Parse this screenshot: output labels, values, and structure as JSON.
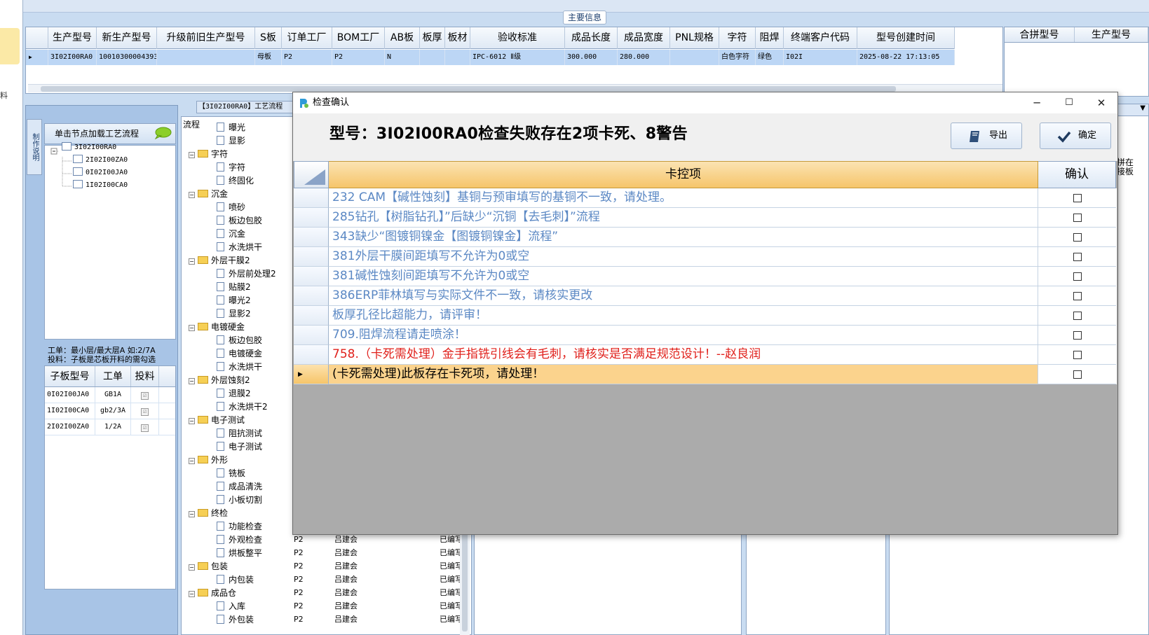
{
  "left_strip": {
    "text": "料"
  },
  "main_info": {
    "title": "主要信息",
    "columns": [
      "生产型号",
      "新生产型号",
      "升级前旧生产型号",
      "S板",
      "订单工厂",
      "BOM工厂",
      "AB板",
      "板厚",
      "板材",
      "验收标准",
      "成品长度",
      "成品宽度",
      "PNL规格",
      "字符",
      "阻焊",
      "终端客户代码",
      "型号创建时间"
    ],
    "row": [
      "3I02I00RA0",
      "10010300004393",
      "",
      "母板",
      "P2",
      "P2",
      "N",
      "",
      "",
      "IPC-6012 Ⅱ级",
      "300.000",
      "280.000",
      "",
      "白色字符",
      "绿色",
      "I02I",
      "2025-08-22 17:13:05"
    ]
  },
  "right_grid": {
    "columns": [
      "合拼型号",
      "生产型号"
    ]
  },
  "left_panel": {
    "vertical_tab": "制作说明",
    "tree_header": "单击节点加载工艺流程",
    "tree_nodes": [
      "3I02I00RA0",
      "2I02I00ZA0",
      "0I02I00JA0",
      "1I02I00CA0"
    ],
    "note_line1": "工单：最小层/最大层A 如:2/7A",
    "note_line2": "投料：子板是芯板开料的需勾选",
    "sub_columns": [
      "子板型号",
      "工单",
      "投料"
    ],
    "sub_rows": [
      {
        "model": "0I02I00JA0",
        "order": "GB1A",
        "feed": "☑"
      },
      {
        "model": "1I02I00CA0",
        "order": "gb2/3A",
        "feed": "☑"
      },
      {
        "model": "2I02I00ZA0",
        "order": "1/2A",
        "feed": "☑"
      }
    ]
  },
  "process": {
    "title": "【3I02I00RA0】工艺流程",
    "column_label": "流程",
    "nodes": [
      {
        "type": "doc",
        "label": "曝光"
      },
      {
        "type": "doc",
        "label": "显影"
      },
      {
        "type": "folder",
        "label": "字符"
      },
      {
        "type": "doc",
        "label": "字符"
      },
      {
        "type": "doc",
        "label": "终固化"
      },
      {
        "type": "folder",
        "label": "沉金"
      },
      {
        "type": "doc",
        "label": "喷砂"
      },
      {
        "type": "doc",
        "label": "板边包胶"
      },
      {
        "type": "doc",
        "label": "沉金"
      },
      {
        "type": "doc",
        "label": "水洗烘干"
      },
      {
        "type": "folder",
        "label": "外层干膜2"
      },
      {
        "type": "doc",
        "label": "外层前处理2"
      },
      {
        "type": "doc",
        "label": "贴膜2"
      },
      {
        "type": "doc",
        "label": "曝光2"
      },
      {
        "type": "doc",
        "label": "显影2"
      },
      {
        "type": "folder",
        "label": "电镀硬金"
      },
      {
        "type": "doc",
        "label": "板边包胶"
      },
      {
        "type": "doc",
        "label": "电镀硬金"
      },
      {
        "type": "doc",
        "label": "水洗烘干"
      },
      {
        "type": "folder",
        "label": "外层蚀刻2"
      },
      {
        "type": "doc",
        "label": "退膜2"
      },
      {
        "type": "doc",
        "label": "水洗烘干2"
      },
      {
        "type": "folder",
        "label": "电子测试"
      },
      {
        "type": "doc",
        "label": "阻抗测试"
      },
      {
        "type": "doc",
        "label": "电子测试"
      },
      {
        "type": "folder",
        "label": "外形"
      },
      {
        "type": "doc",
        "label": "铣板"
      },
      {
        "type": "doc",
        "label": "成品清洗"
      },
      {
        "type": "doc",
        "label": "小板切割"
      },
      {
        "type": "folder",
        "label": "终检"
      },
      {
        "type": "doc",
        "label": "功能检查"
      },
      {
        "type": "doc",
        "label": "外观检查",
        "factory": "P2",
        "person": "吕建会",
        "status": "已编写"
      },
      {
        "type": "doc",
        "label": "烘板整平",
        "factory": "P2",
        "person": "吕建会",
        "status": "已编写"
      },
      {
        "type": "folder",
        "label": "包装",
        "factory": "P2",
        "person": "吕建会",
        "status": "已编写"
      },
      {
        "type": "doc",
        "label": "内包装",
        "factory": "P2",
        "person": "吕建会",
        "status": "已编写"
      },
      {
        "type": "folder",
        "label": "成品仓",
        "factory": "P2",
        "person": "吕建会",
        "status": "已编写"
      },
      {
        "type": "doc",
        "label": "入库",
        "factory": "P2",
        "person": "吕建会",
        "status": "已编写"
      },
      {
        "type": "doc",
        "label": "外包装",
        "factory": "P2",
        "person": "吕建会",
        "status": "已编写"
      }
    ]
  },
  "right_cut_text": "拼在\n接板",
  "dialog": {
    "title": "检查确认",
    "minimize": "─",
    "maximize": "☐",
    "close": "✕",
    "summary": "型号：3I02I00RA0检查失败存在2项卡死、8警告",
    "export_label": "导出",
    "confirm_label": "确定",
    "col_item": "卡控项",
    "col_confirm": "确认",
    "colors": {
      "warning": "#5b88c4",
      "blocking": "#e0201b",
      "selected_row": "#fbd38d",
      "header": "#f6c56a"
    },
    "rows": [
      {
        "text": "232 CAM【碱性蚀刻】基铜与预审填写的基铜不一致，请处理。",
        "level": "warning",
        "confirmed": false
      },
      {
        "text": "285钻孔【树脂钻孔】”后缺少“沉铜【去毛刺】”流程",
        "level": "warning",
        "confirmed": false
      },
      {
        "text": "343缺少“图镀铜镍金【图镀铜镍金】流程”",
        "level": "warning",
        "confirmed": false
      },
      {
        "text": "381外层干膜间距填写不允许为0或空",
        "level": "warning",
        "confirmed": false
      },
      {
        "text": "381碱性蚀刻间距填写不允许为0或空",
        "level": "warning",
        "confirmed": false
      },
      {
        "text": "386ERP菲林填写与实际文件不一致，请核实更改",
        "level": "warning",
        "confirmed": false
      },
      {
        "text": "板厚孔径比超能力，请评审！",
        "level": "warning",
        "confirmed": false
      },
      {
        "text": "709.阻焊流程请走喷涂！",
        "level": "warning",
        "confirmed": false
      },
      {
        "text": "758.（卡死需处理）金手指铣引线会有毛刺，请核实是否满足规范设计！--赵良润",
        "level": "blocking",
        "confirmed": false
      },
      {
        "text": "(卡死需处理)此板存在卡死项，请处理！",
        "level": "selected",
        "confirmed": false
      }
    ]
  }
}
